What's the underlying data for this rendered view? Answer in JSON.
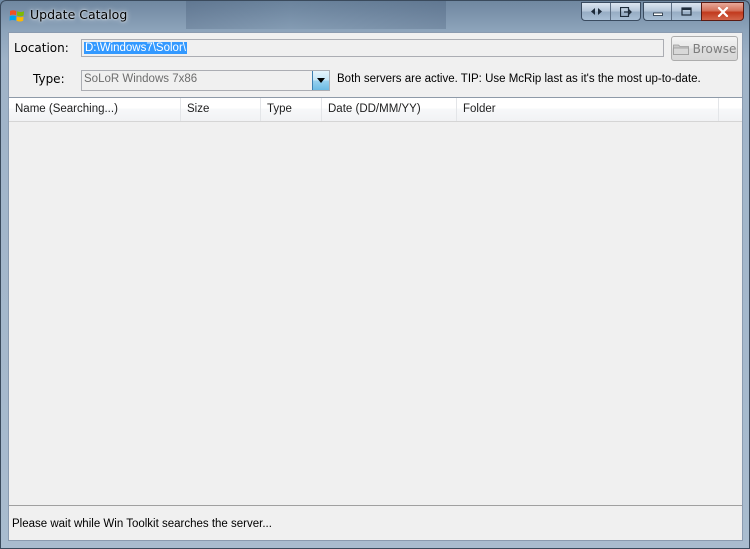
{
  "window": {
    "title": "Update Catalog"
  },
  "form": {
    "location_label": "Location:",
    "location_value": "D:\\Windows7\\Solor\\",
    "browse_label": "Browse",
    "type_label": "Type:",
    "type_value": "SoLoR Windows 7x86",
    "tip_text": "Both servers are active. TIP: Use McRip last as it's the most up-to-date."
  },
  "list": {
    "columns": [
      "Name (Searching...)",
      "Size",
      "Type",
      "Date (DD/MM/YY)",
      "Folder"
    ]
  },
  "status": {
    "text": "Please wait while Win Toolkit searches the server..."
  },
  "icons": {
    "app": "windows-flag-icon",
    "restore_left": "arrows-left-right-icon",
    "restore_right": "window-export-icon",
    "minimize": "minimize-icon",
    "maximize": "maximize-icon",
    "close": "close-icon",
    "browse": "folder-icon",
    "dropdown": "chevron-down-icon"
  },
  "colors": {
    "selection": "#3399ff",
    "close_button": "#c23a1d",
    "client_bg": "#f0f0f0"
  }
}
